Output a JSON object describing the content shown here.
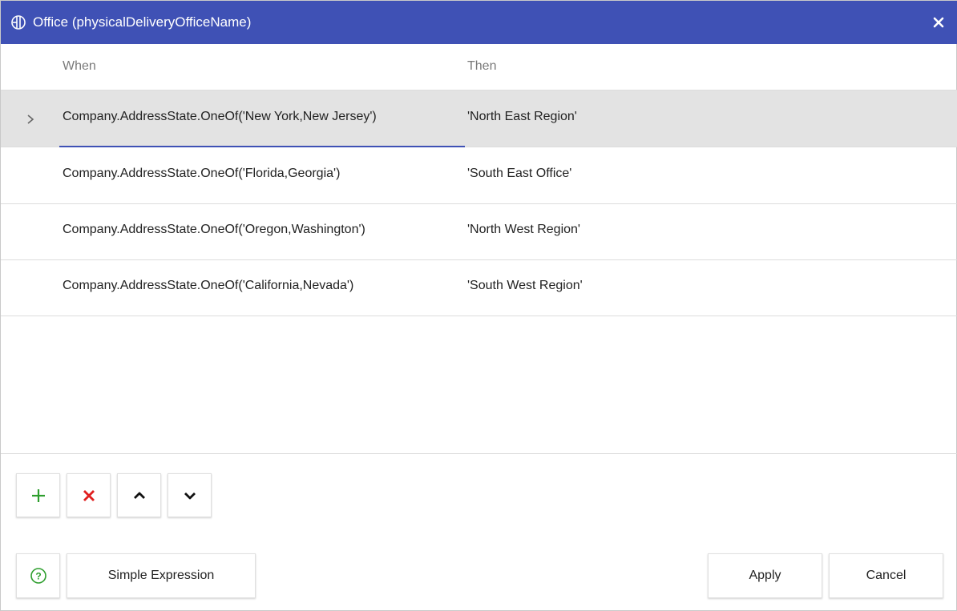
{
  "dialog": {
    "title": "Office (physicalDeliveryOfficeName)",
    "title_icon": "logo-icon",
    "close_icon": "close-icon",
    "accent_color": "#3f51b5"
  },
  "grid": {
    "columns": {
      "when": "When",
      "then": "Then"
    },
    "rows": [
      {
        "when": "Company.AddressState.OneOf('New York,New Jersey')",
        "then": "'North East Region'",
        "selected": true
      },
      {
        "when": "Company.AddressState.OneOf('Florida,Georgia')",
        "then": "'South East Office'",
        "selected": false
      },
      {
        "when": "Company.AddressState.OneOf('Oregon,Washington')",
        "then": "'North West Region'",
        "selected": false
      },
      {
        "when": "Company.AddressState.OneOf('California,Nevada')",
        "then": "'South West Region'",
        "selected": false
      }
    ]
  },
  "toolbar": {
    "add_icon": "plus-icon",
    "delete_icon": "x-icon",
    "move_up_icon": "chevron-up-icon",
    "move_down_icon": "chevron-down-icon",
    "add_color": "#2e9e2e",
    "delete_color": "#e02020"
  },
  "footer": {
    "help_icon": "help-icon",
    "simple_expression_label": "Simple Expression",
    "apply_label": "Apply",
    "cancel_label": "Cancel"
  }
}
